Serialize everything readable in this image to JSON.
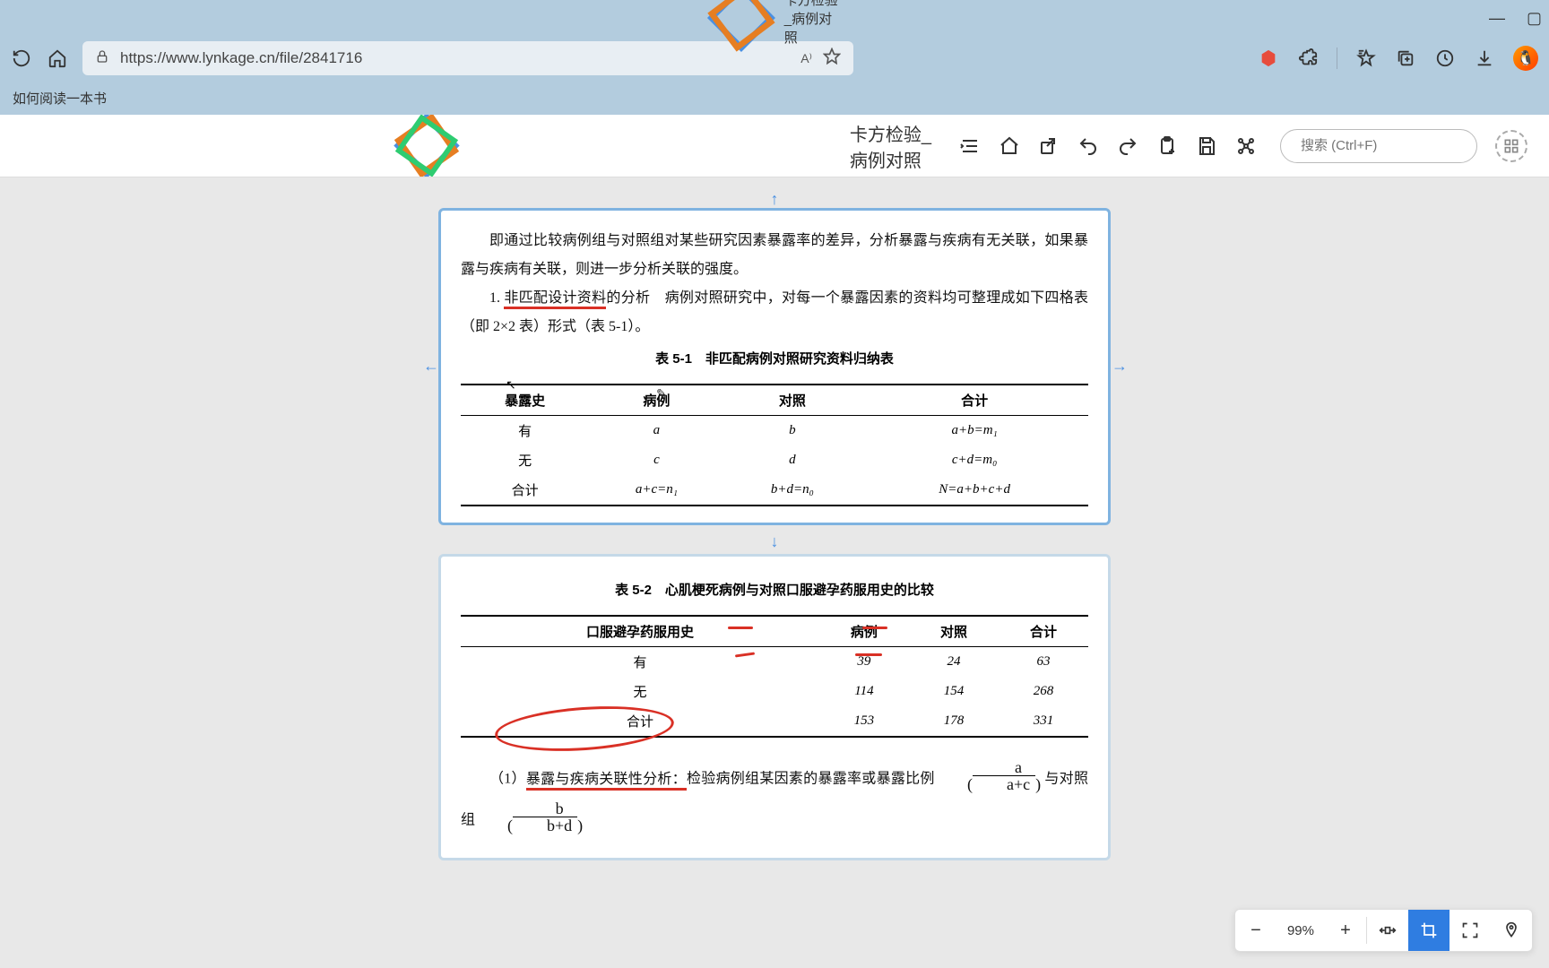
{
  "window": {
    "title": "卡方检验_病例对照"
  },
  "browser": {
    "url": "https://www.lynkage.cn/file/2841716",
    "bookmark": "如何阅读一本书"
  },
  "app": {
    "title": "卡方检验_病例对照",
    "search_placeholder": "搜索 (Ctrl+F)"
  },
  "zoom": {
    "level": "99%"
  },
  "card1": {
    "para1": "即通过比较病例组与对照组对某些研究因素暴露率的差异，分析暴露与疾病有无关联，如果暴露与疾病有关联，则进一步分析关联的强度。",
    "point_label": "1. ",
    "underlined": "非匹配设计资料",
    "point_rest": "的分析　病例对照研究中，对每一个暴露因素的资料均可整理成如下四格表（即 2×2 表）形式（表 5-1）。",
    "table": {
      "caption": "表 5-1　非匹配病例对照研究资料归纳表",
      "headers": [
        "暴露史",
        "病例",
        "对照",
        "合计"
      ],
      "rows": [
        [
          "有",
          "a",
          "b",
          "a+b=m₁"
        ],
        [
          "无",
          "c",
          "d",
          "c+d=m₀"
        ],
        [
          "合计",
          "a+c=n₁",
          "b+d=n₀",
          "N=a+b+c+d"
        ]
      ]
    }
  },
  "card2": {
    "table": {
      "caption": "表 5-2　心肌梗死病例与对照口服避孕药服用史的比较",
      "headers": [
        "口服避孕药服用史",
        "病例",
        "对照",
        "合计"
      ],
      "rows": [
        [
          "有",
          "39",
          "24",
          "63"
        ],
        [
          "无",
          "114",
          "154",
          "268"
        ],
        [
          "合计",
          "153",
          "178",
          "331"
        ]
      ]
    },
    "analysis_label": "（1）",
    "analysis_circled": "暴露与疾病关联性分析：",
    "analysis_rest": "检验病例组某因素的暴露率或暴露比例",
    "frac1_num": "a",
    "frac1_den": "a+c",
    "analysis_mid": "与对照组",
    "frac2_num": "b",
    "frac2_den": "b+d"
  },
  "icons": {
    "reload": "reload-icon",
    "home": "home-icon",
    "lock": "lock-icon",
    "read_aloud": "read-aloud-icon",
    "favorite": "favorite-icon",
    "adblock": "adblock-icon",
    "extensions": "extensions-icon",
    "favorites_list": "favorites-list-icon",
    "collections": "collections-icon",
    "history": "history-icon",
    "downloads": "downloads-icon",
    "outline": "outline-icon",
    "home2": "home2-icon",
    "share": "share-icon",
    "undo": "undo-icon",
    "redo": "redo-icon",
    "clipboard": "clipboard-icon",
    "save": "save-icon",
    "graph": "graph-icon"
  }
}
